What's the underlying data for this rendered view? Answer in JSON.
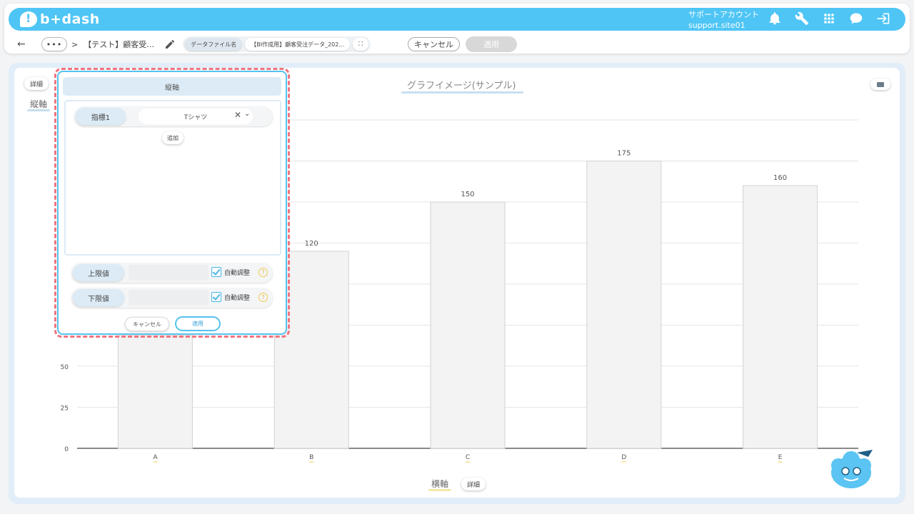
{
  "header": {
    "logo_text": "b+dash",
    "account_label": "サポートアカウント",
    "account_id": "support.site01",
    "icons": [
      "bell-icon",
      "wrench-icon",
      "grid-icon",
      "chat-icon",
      "logout-icon"
    ]
  },
  "toolbar": {
    "back": "←",
    "more": "•••",
    "separator": ">",
    "breadcrumb": "【テスト】顧客受…",
    "file_label": "データファイル名",
    "file_name": "【BI作成用】顧客受注データ_202…",
    "expand": "⛶",
    "cancel": "キャンセル",
    "apply": "適用"
  },
  "chart_area": {
    "vertical_detail": "詳細",
    "vertical_axis": "縦軸",
    "horizontal_axis": "横軸",
    "horizontal_detail": "詳細"
  },
  "popup": {
    "title": "縦軸",
    "metric_label": "指標1",
    "metric_value": "Tシャツ",
    "clear": "✕",
    "chevron": "⌄",
    "add": "追加",
    "upper_label": "上限値",
    "lower_label": "下限値",
    "auto_adjust": "自動調整",
    "help": "?",
    "cancel": "キャンセル",
    "apply": "適用"
  },
  "colors": {
    "brand": "#4ec5f5",
    "highlight": "#f0747e",
    "bar_fill": "#f3f3f3"
  },
  "chart_data": {
    "type": "bar",
    "title": "グラフイメージ(サンプル)",
    "categories": [
      "A",
      "B",
      "C",
      "D",
      "E"
    ],
    "values": [
      null,
      120,
      150,
      175,
      160
    ],
    "value_labels": [
      "",
      "120",
      "150",
      "175",
      "160"
    ],
    "yticks": [
      0,
      25,
      50
    ],
    "ylim": [
      0,
      200
    ],
    "grid": true
  }
}
